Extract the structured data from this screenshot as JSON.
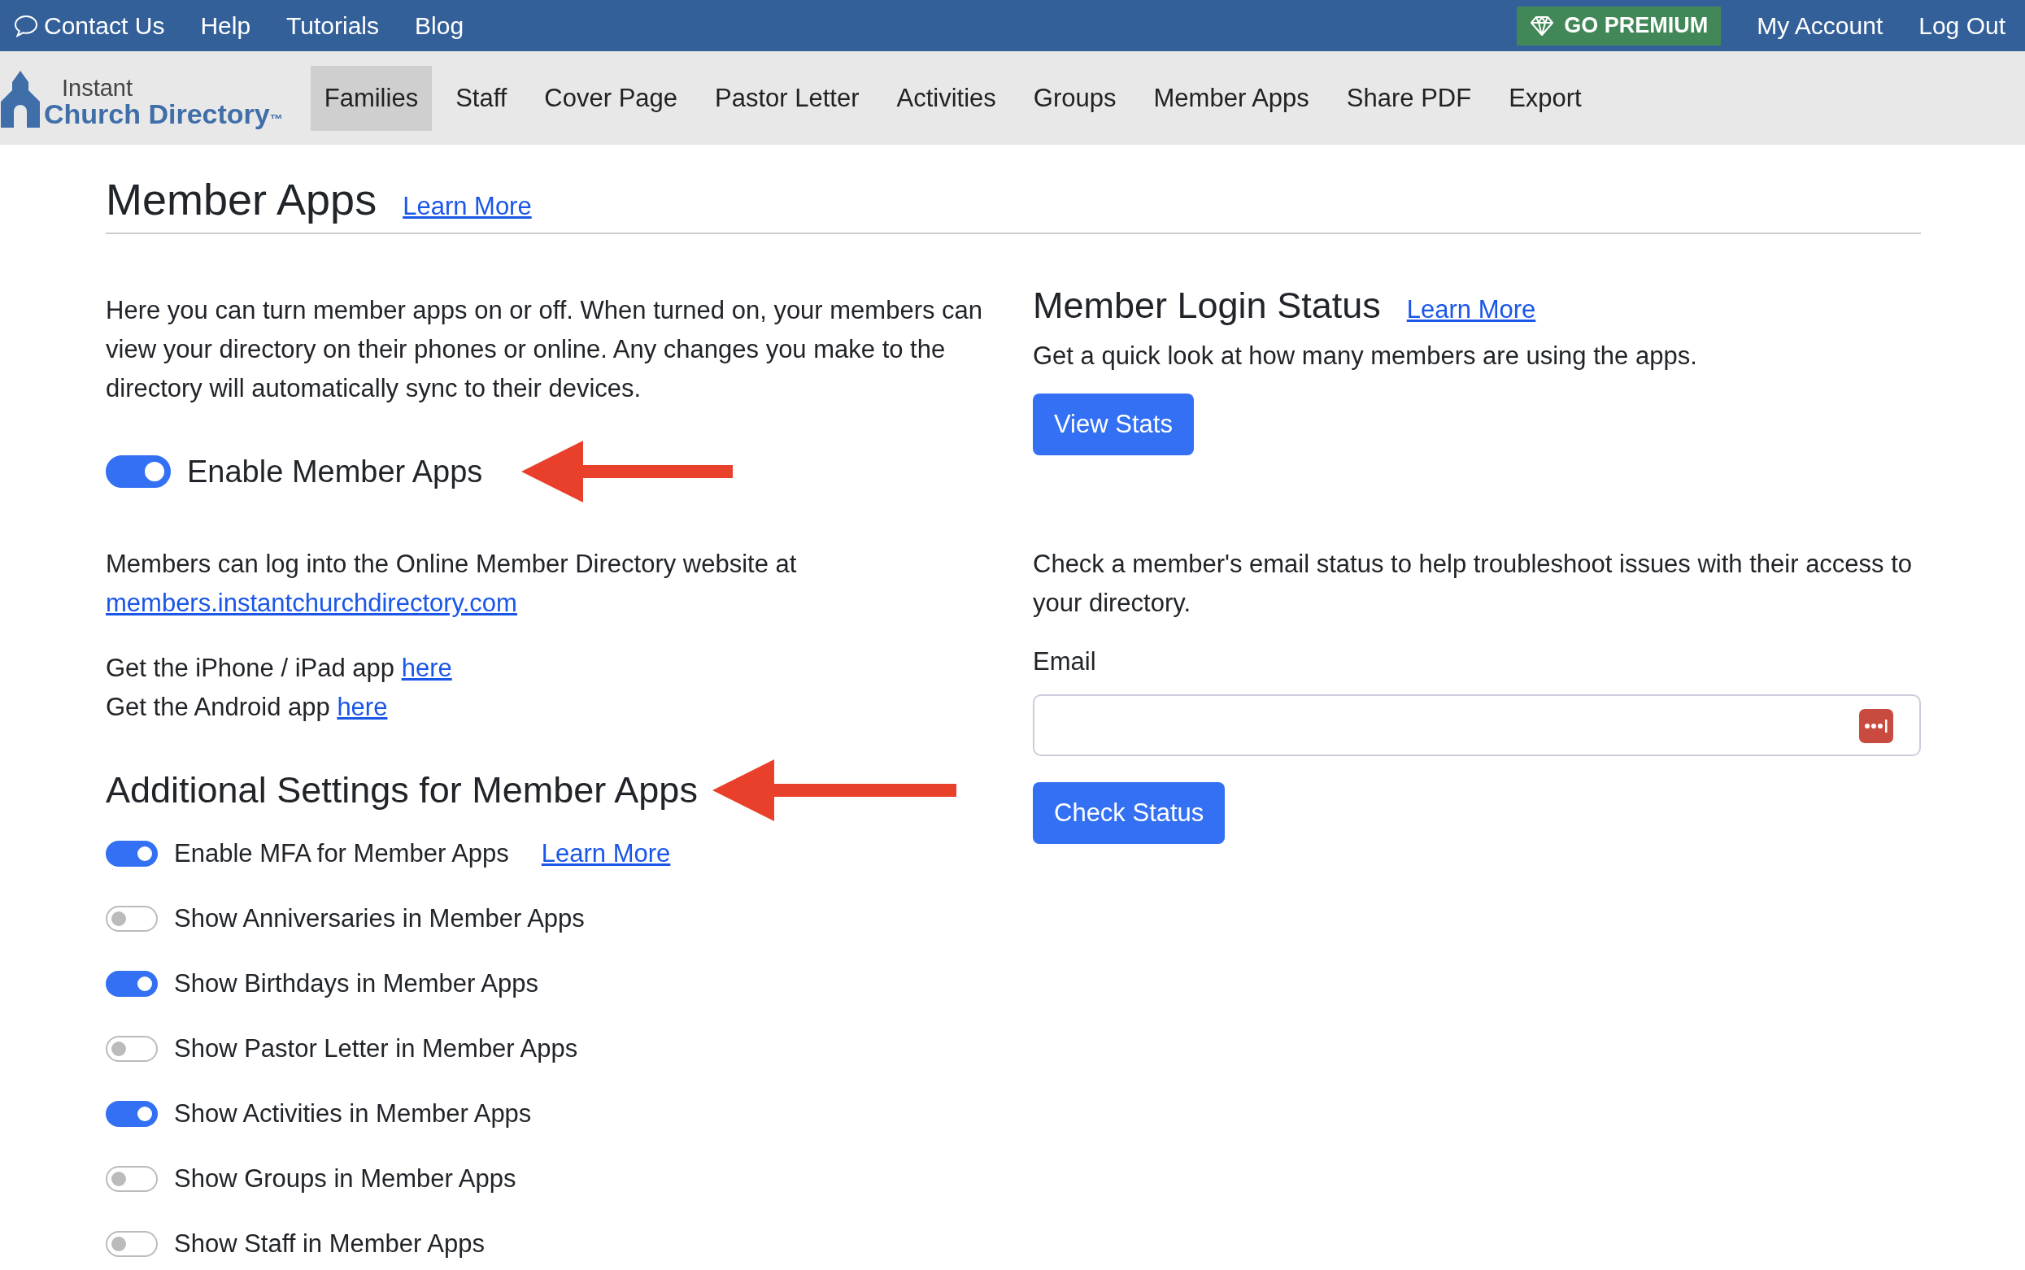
{
  "top_bar": {
    "contact": "Contact Us",
    "links": [
      "Help",
      "Tutorials",
      "Blog"
    ],
    "premium": "GO PREMIUM",
    "account_links": [
      "My Account",
      "Log Out"
    ]
  },
  "logo": {
    "line_1": "Instant",
    "line_2": "Church Directory",
    "trademark": "™"
  },
  "nav_tabs": [
    {
      "label": "Families",
      "selected": true
    },
    {
      "label": "Staff",
      "selected": false
    },
    {
      "label": "Cover Page",
      "selected": false
    },
    {
      "label": "Pastor Letter",
      "selected": false
    },
    {
      "label": "Activities",
      "selected": false
    },
    {
      "label": "Groups",
      "selected": false
    },
    {
      "label": "Member Apps",
      "selected": false
    },
    {
      "label": "Share PDF",
      "selected": false
    },
    {
      "label": "Export",
      "selected": false
    }
  ],
  "page": {
    "title": "Member Apps",
    "learn_more": "Learn More"
  },
  "left": {
    "intro": "Here you can turn member apps on or off. When turned on, your members can view your directory on their phones or online. Any changes you make to the directory will automatically sync to their devices.",
    "main_toggle": {
      "label": "Enable Member Apps",
      "on": true
    },
    "online_text": "Members can log into the Online Member Directory website at",
    "online_link": "members.instantchurchdirectory.com",
    "app_lines": [
      {
        "text": "Get the iPhone / iPad app",
        "link": "here"
      },
      {
        "text": "Get the Android app",
        "link": "here"
      }
    ],
    "settings_title": "Additional Settings for Member Apps",
    "settings": [
      {
        "label": "Enable MFA for Member Apps",
        "on": true,
        "link": "Learn More"
      },
      {
        "label": "Show Anniversaries in Member Apps",
        "on": false
      },
      {
        "label": "Show Birthdays in Member Apps",
        "on": true
      },
      {
        "label": "Show Pastor Letter in Member Apps",
        "on": false
      },
      {
        "label": "Show Activities in Member Apps",
        "on": true
      },
      {
        "label": "Show Groups in Member Apps",
        "on": false
      },
      {
        "label": "Show Staff in Member Apps",
        "on": false
      }
    ]
  },
  "right": {
    "title": "Member Login Status",
    "learn_more": "Learn More",
    "description": "Get a quick look at how many members are using the apps.",
    "view_button": "View Stats",
    "check_text": "Check a member's email status to help troubleshoot issues with their access to your directory.",
    "email_label": "Email",
    "check_button": "Check Status"
  }
}
